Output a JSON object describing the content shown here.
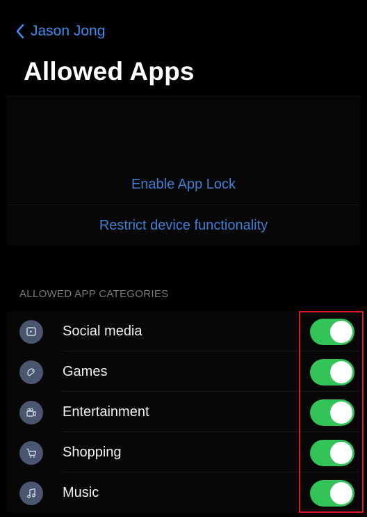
{
  "nav": {
    "back_label": "Jason Jong"
  },
  "page": {
    "title": "Allowed Apps"
  },
  "actions": {
    "enable_app_lock": "Enable App Lock",
    "restrict_device": "Restrict device functionality"
  },
  "section": {
    "header": "ALLOWED APP CATEGORIES"
  },
  "categories": [
    {
      "label": "Social media",
      "icon": "social-media-icon",
      "enabled": true
    },
    {
      "label": "Games",
      "icon": "games-icon",
      "enabled": true
    },
    {
      "label": "Entertainment",
      "icon": "entertainment-icon",
      "enabled": true
    },
    {
      "label": "Shopping",
      "icon": "shopping-icon",
      "enabled": true
    },
    {
      "label": "Music",
      "icon": "music-icon",
      "enabled": true
    }
  ],
  "colors": {
    "accent": "#3a8ef0",
    "toggle_on": "#33c459",
    "icon_bg": "#4a5570",
    "highlight": "#e0191e"
  }
}
